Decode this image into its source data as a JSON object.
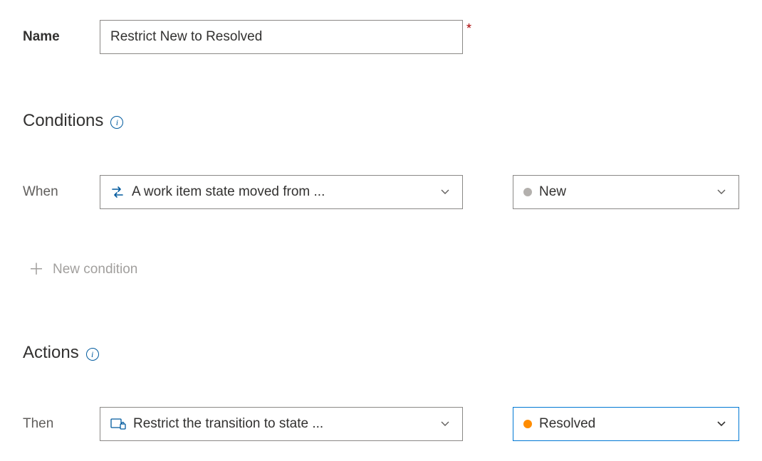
{
  "name": {
    "label": "Name",
    "value": "Restrict New to Resolved"
  },
  "conditions": {
    "heading": "Conditions",
    "when_label": "When",
    "when_dropdown": "A work item state moved from ...",
    "state_dropdown": "New",
    "new_condition": "New condition"
  },
  "actions": {
    "heading": "Actions",
    "then_label": "Then",
    "then_dropdown": "Restrict the transition to state ...",
    "state_dropdown": "Resolved"
  }
}
